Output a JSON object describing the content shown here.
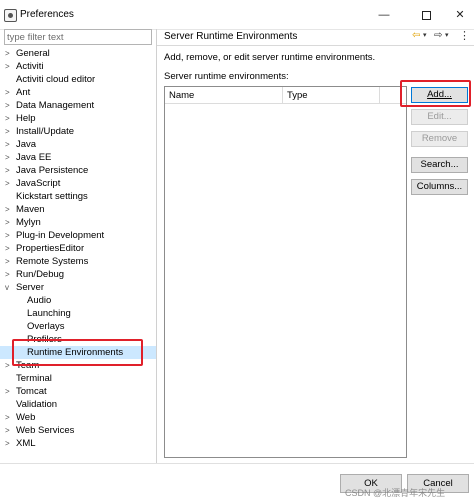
{
  "window": {
    "title": "Preferences",
    "minimize": "—",
    "close": "✕"
  },
  "filter": {
    "placeholder": "type filter text"
  },
  "tree": {
    "items": [
      {
        "label": "General",
        "arrow": ">",
        "level": 0
      },
      {
        "label": "Activiti",
        "arrow": ">",
        "level": 0
      },
      {
        "label": "Activiti cloud editor",
        "arrow": "",
        "level": 0
      },
      {
        "label": "Ant",
        "arrow": ">",
        "level": 0
      },
      {
        "label": "Data Management",
        "arrow": ">",
        "level": 0
      },
      {
        "label": "Help",
        "arrow": ">",
        "level": 0
      },
      {
        "label": "Install/Update",
        "arrow": ">",
        "level": 0
      },
      {
        "label": "Java",
        "arrow": ">",
        "level": 0
      },
      {
        "label": "Java EE",
        "arrow": ">",
        "level": 0
      },
      {
        "label": "Java Persistence",
        "arrow": ">",
        "level": 0
      },
      {
        "label": "JavaScript",
        "arrow": ">",
        "level": 0
      },
      {
        "label": "Kickstart settings",
        "arrow": "",
        "level": 0
      },
      {
        "label": "Maven",
        "arrow": ">",
        "level": 0
      },
      {
        "label": "Mylyn",
        "arrow": ">",
        "level": 0
      },
      {
        "label": "Plug-in Development",
        "arrow": ">",
        "level": 0
      },
      {
        "label": "PropertiesEditor",
        "arrow": ">",
        "level": 0
      },
      {
        "label": "Remote Systems",
        "arrow": ">",
        "level": 0
      },
      {
        "label": "Run/Debug",
        "arrow": ">",
        "level": 0
      },
      {
        "label": "Server",
        "arrow": "v",
        "level": 0
      },
      {
        "label": "Audio",
        "arrow": "",
        "level": 1
      },
      {
        "label": "Launching",
        "arrow": "",
        "level": 1
      },
      {
        "label": "Overlays",
        "arrow": "",
        "level": 1
      },
      {
        "label": "Profilers",
        "arrow": "",
        "level": 1
      },
      {
        "label": "Runtime Environments",
        "arrow": "",
        "level": 1,
        "selected": true
      },
      {
        "label": "Team",
        "arrow": ">",
        "level": 0
      },
      {
        "label": "Terminal",
        "arrow": "",
        "level": 0
      },
      {
        "label": "Tomcat",
        "arrow": ">",
        "level": 0
      },
      {
        "label": "Validation",
        "arrow": "",
        "level": 0
      },
      {
        "label": "Web",
        "arrow": ">",
        "level": 0
      },
      {
        "label": "Web Services",
        "arrow": ">",
        "level": 0
      },
      {
        "label": "XML",
        "arrow": ">",
        "level": 0
      }
    ]
  },
  "page": {
    "title": "Server Runtime Environments",
    "description": "Add, remove, or edit server runtime environments.",
    "list_label": "Server runtime environments:",
    "nav": {
      "back": "⇦",
      "forward": "⇨",
      "drop": "▾",
      "menu": "⋮"
    }
  },
  "table": {
    "columns": [
      "Name",
      "Type",
      ""
    ],
    "rows": []
  },
  "buttons": {
    "add": "Add...",
    "edit": "Edit...",
    "remove": "Remove",
    "search": "Search...",
    "columns": "Columns..."
  },
  "footer": {
    "ok": "OK",
    "cancel": "Cancel",
    "watermark": "CSDN @北漂青年宋先生"
  },
  "colors": {
    "highlight": "#e0202a",
    "selection": "#cce8ff",
    "focus": "#0078d7"
  }
}
